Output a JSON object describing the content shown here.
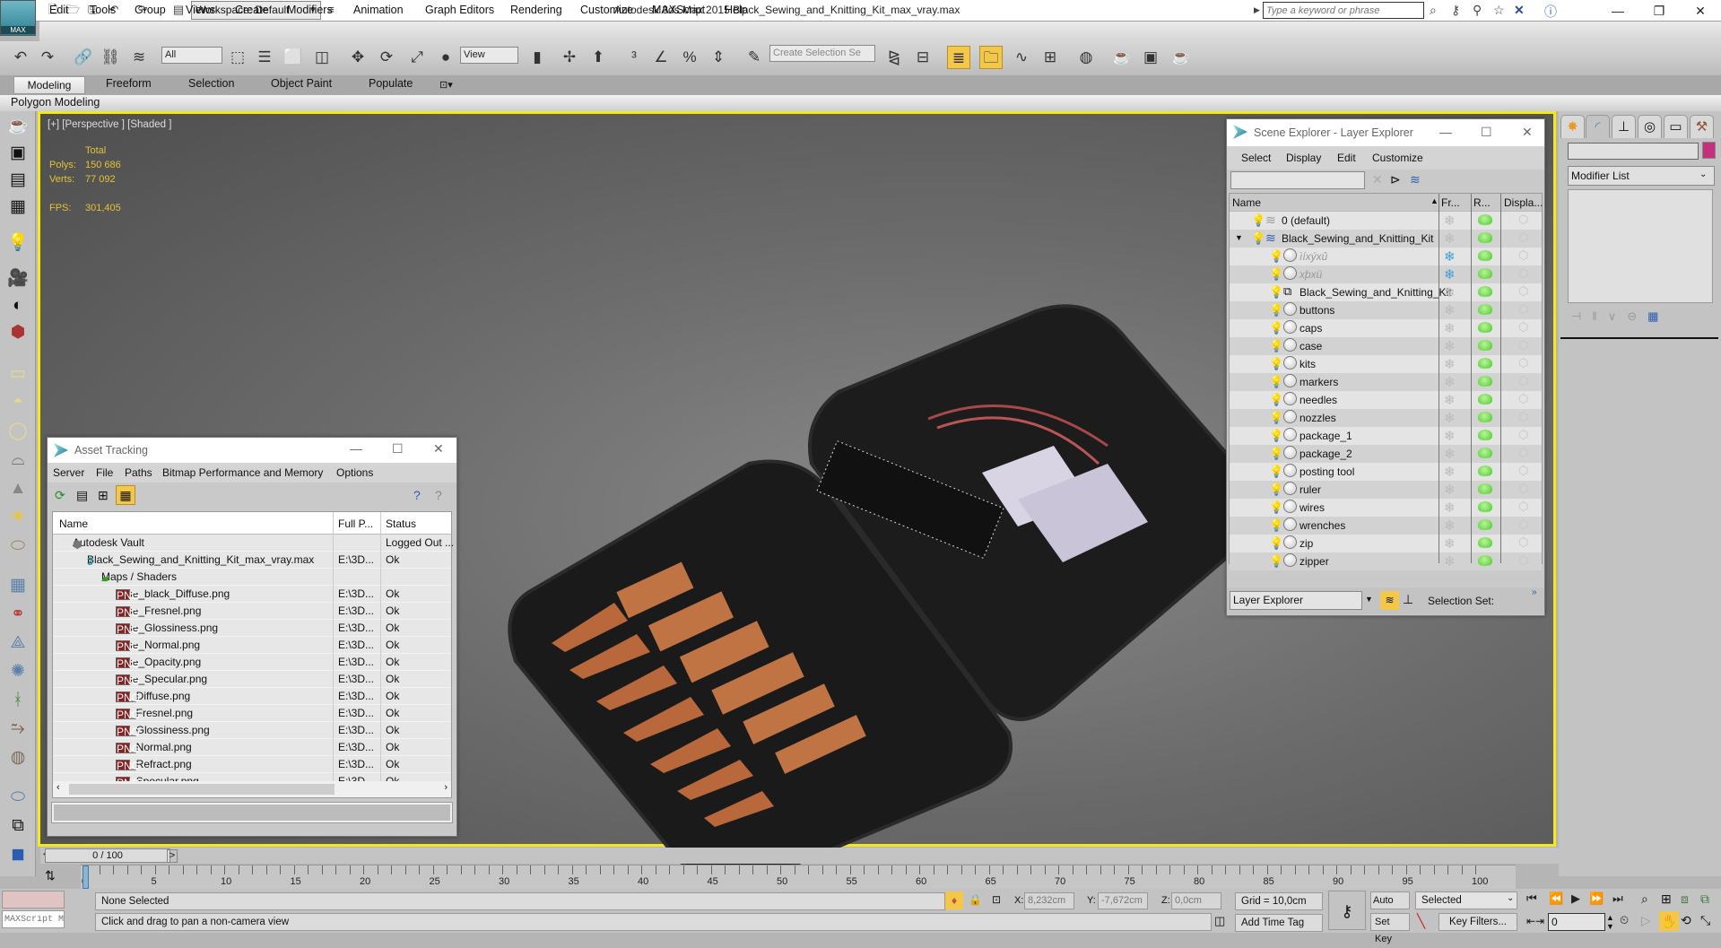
{
  "app": {
    "title": "Autodesk 3ds Max  2015    Black_Sewing_and_Knitting_Kit_max_vray.max",
    "logo_label": "MAX",
    "workspace": "Workspace: Default",
    "search_placeholder": "Type a keyword or phrase"
  },
  "menu": [
    "Edit",
    "Tools",
    "Group",
    "Views",
    "Create",
    "Modifiers",
    "Animation",
    "Graph Editors",
    "Rendering",
    "Customize",
    "MAXScript",
    "Help"
  ],
  "toolbar": {
    "selection_filter": "All",
    "reference_coord": "View",
    "named_selection_placeholder": "Create Selection Se"
  },
  "ribbon": {
    "tabs": [
      "Modeling",
      "Freeform",
      "Selection",
      "Object Paint",
      "Populate"
    ],
    "active_tab": "Modeling",
    "panel": "Polygon Modeling"
  },
  "viewport": {
    "label": "[+] [Perspective ] [Shaded ]",
    "stats": {
      "header": "Total",
      "polys_label": "Polys:",
      "polys": "150 686",
      "verts_label": "Verts:",
      "verts": "77 092",
      "fps_label": "FPS:",
      "fps": "301,405"
    },
    "accent_color": "#f4e81b"
  },
  "asset_tracking": {
    "title": "Asset Tracking",
    "menu": [
      "Server",
      "File",
      "Paths",
      "Bitmap Performance and Memory",
      "Options"
    ],
    "columns": [
      "Name",
      "Full P...",
      "Status"
    ],
    "rows": [
      {
        "name": "Autodesk Vault",
        "path": "",
        "status": "Logged Out ...",
        "level": 0,
        "icon": "vault-icon"
      },
      {
        "name": "Black_Sewing_and_Knitting_Kit_max_vray.max",
        "path": "E:\\3D...",
        "status": "Ok",
        "level": 1,
        "icon": "max-file-icon"
      },
      {
        "name": "Maps / Shaders",
        "path": "",
        "status": "",
        "level": 2,
        "icon": "maps-folder-icon"
      },
      {
        "name": "case_black_Diffuse.png",
        "path": "E:\\3D...",
        "status": "Ok",
        "level": 3,
        "icon": "png-icon"
      },
      {
        "name": "case_Fresnel.png",
        "path": "E:\\3D...",
        "status": "Ok",
        "level": 3,
        "icon": "png-icon"
      },
      {
        "name": "case_Glossiness.png",
        "path": "E:\\3D...",
        "status": "Ok",
        "level": 3,
        "icon": "png-icon"
      },
      {
        "name": "case_Normal.png",
        "path": "E:\\3D...",
        "status": "Ok",
        "level": 3,
        "icon": "png-icon"
      },
      {
        "name": "case_Opacity.png",
        "path": "E:\\3D...",
        "status": "Ok",
        "level": 3,
        "icon": "png-icon"
      },
      {
        "name": "case_Specular.png",
        "path": "E:\\3D...",
        "status": "Ok",
        "level": 3,
        "icon": "png-icon"
      },
      {
        "name": "set_Diffuse.png",
        "path": "E:\\3D...",
        "status": "Ok",
        "level": 3,
        "icon": "png-icon"
      },
      {
        "name": "set_Fresnel.png",
        "path": "E:\\3D...",
        "status": "Ok",
        "level": 3,
        "icon": "png-icon"
      },
      {
        "name": "set_Glossiness.png",
        "path": "E:\\3D...",
        "status": "Ok",
        "level": 3,
        "icon": "png-icon"
      },
      {
        "name": "set_Normal.png",
        "path": "E:\\3D...",
        "status": "Ok",
        "level": 3,
        "icon": "png-icon"
      },
      {
        "name": "set_Refract.png",
        "path": "E:\\3D...",
        "status": "Ok",
        "level": 3,
        "icon": "png-icon"
      },
      {
        "name": "set_Specular.png",
        "path": "E:\\3D...",
        "status": "Ok",
        "level": 3,
        "icon": "png-icon"
      }
    ]
  },
  "scene_explorer": {
    "title": "Scene Explorer - Layer Explorer",
    "menu": [
      "Select",
      "Display",
      "Edit",
      "Customize"
    ],
    "columns": [
      "Name",
      "Fr...",
      "R...",
      "Displa..."
    ],
    "rows": [
      {
        "name": "0 (default)",
        "level": 0,
        "type": "layer",
        "hidden": false,
        "frozen": false
      },
      {
        "name": "Black_Sewing_and_Knitting_Kit",
        "level": 0,
        "type": "layer-active",
        "hidden": false,
        "frozen": false,
        "expanded": true
      },
      {
        "name": "ìíxýxû",
        "level": 1,
        "type": "object",
        "hidden": true,
        "frozen": true
      },
      {
        "name": "xþxü",
        "level": 1,
        "type": "object",
        "hidden": true,
        "frozen": true
      },
      {
        "name": "Black_Sewing_and_Knitting_Kit",
        "level": 1,
        "type": "group",
        "hidden": false,
        "frozen": false
      },
      {
        "name": "buttons",
        "level": 1,
        "type": "object",
        "hidden": false,
        "frozen": false
      },
      {
        "name": "caps",
        "level": 1,
        "type": "object",
        "hidden": false,
        "frozen": false
      },
      {
        "name": "case",
        "level": 1,
        "type": "object",
        "hidden": false,
        "frozen": false
      },
      {
        "name": "kits",
        "level": 1,
        "type": "object",
        "hidden": false,
        "frozen": false
      },
      {
        "name": "markers",
        "level": 1,
        "type": "object",
        "hidden": false,
        "frozen": false
      },
      {
        "name": "needles",
        "level": 1,
        "type": "object",
        "hidden": false,
        "frozen": false
      },
      {
        "name": "nozzles",
        "level": 1,
        "type": "object",
        "hidden": false,
        "frozen": false
      },
      {
        "name": "package_1",
        "level": 1,
        "type": "object",
        "hidden": false,
        "frozen": false
      },
      {
        "name": "package_2",
        "level": 1,
        "type": "object",
        "hidden": false,
        "frozen": false
      },
      {
        "name": "posting tool",
        "level": 1,
        "type": "object",
        "hidden": false,
        "frozen": false
      },
      {
        "name": "ruler",
        "level": 1,
        "type": "object",
        "hidden": false,
        "frozen": false
      },
      {
        "name": "wires",
        "level": 1,
        "type": "object",
        "hidden": false,
        "frozen": false
      },
      {
        "name": "wrenches",
        "level": 1,
        "type": "object",
        "hidden": false,
        "frozen": false
      },
      {
        "name": "zip",
        "level": 1,
        "type": "object",
        "hidden": false,
        "frozen": false
      },
      {
        "name": "zipper",
        "level": 1,
        "type": "object",
        "hidden": false,
        "frozen": false
      }
    ],
    "explorer_select": "Layer Explorer",
    "selection_set_label": "Selection Set:"
  },
  "command_panel": {
    "tabs": [
      "create-icon",
      "modify-icon",
      "hierarchy-icon",
      "motion-icon",
      "display-icon",
      "utilities-icon"
    ],
    "object_color": "#c4307e",
    "modifier_list": "Modifier List"
  },
  "timeline": {
    "slider_label": "0 / 100",
    "current_frame": 0,
    "range": [
      0,
      100
    ],
    "labels": [
      0,
      5,
      10,
      15,
      20,
      25,
      30,
      35,
      40,
      45,
      50,
      55,
      60,
      65,
      70,
      75,
      80,
      85,
      90,
      95,
      100
    ]
  },
  "status": {
    "maxscript_placeholder": "MAXScript Mi:",
    "selection": "None Selected",
    "prompt": "Click and drag to pan a non-camera view",
    "x_label": "X:",
    "x": "8,232cm",
    "y_label": "Y:",
    "y": "-7,672cm",
    "z_label": "Z:",
    "z": "0,0cm",
    "grid": "Grid = 10,0cm",
    "add_time_tag": "Add Time Tag",
    "auto_key": "Auto Key",
    "set_key": "Set Key",
    "key_mode": "Selected",
    "key_filters": "Key Filters...",
    "frame_value": "0"
  }
}
